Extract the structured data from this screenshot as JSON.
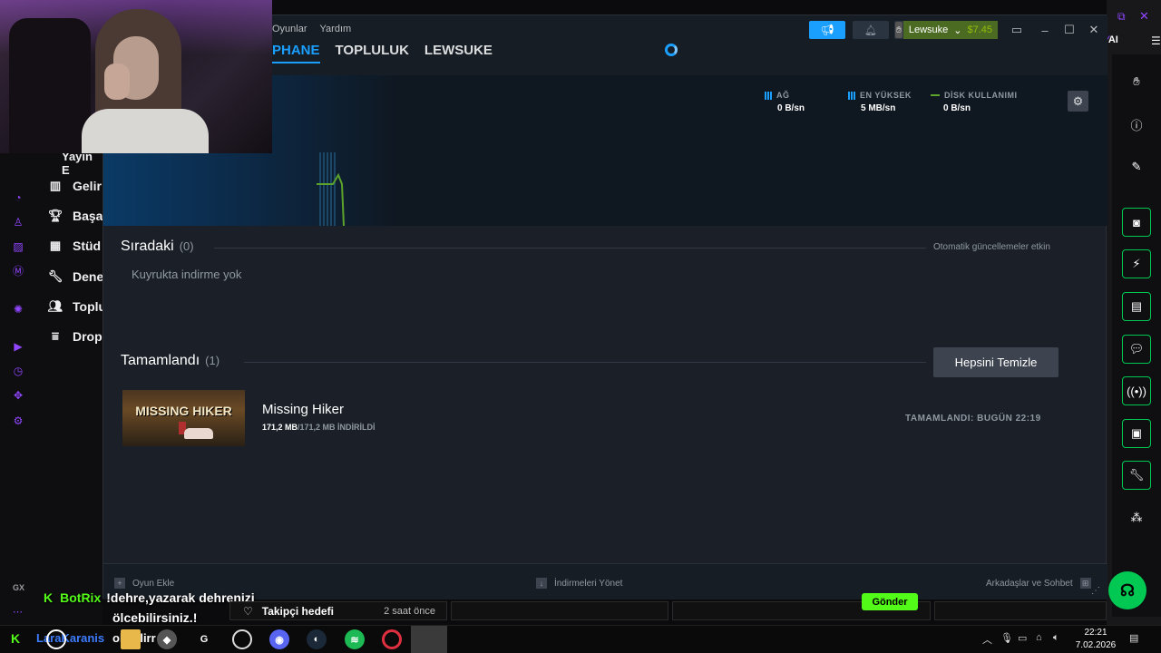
{
  "steam": {
    "menu": [
      "Oyunlar",
      "Yardım"
    ],
    "nav": [
      {
        "label": "PHANE",
        "active": true
      },
      {
        "label": "TOPLULUK",
        "active": false
      },
      {
        "label": "LEWSUKE",
        "active": false
      }
    ],
    "account": {
      "name": "Lewsuke",
      "balance": "$7.45"
    },
    "stats": [
      {
        "label": "AĞ",
        "value": "0 B/sn",
        "icon": "bar-chart-icon"
      },
      {
        "label": "EN YÜKSEK",
        "value": "5 MB/sn",
        "icon": "bar-chart-icon"
      },
      {
        "label": "DİSK KULLANIMI",
        "value": "0 B/sn",
        "icon": "line-icon"
      }
    ],
    "queue": {
      "title": "Sıradaki",
      "count": "(0)",
      "auto_updates": "Otomatik güncellemeler etkin",
      "empty": "Kuyrukta indirme yok"
    },
    "completed": {
      "title": "Tamamlandı",
      "count": "(1)",
      "clear_label": "Hepsini Temizle"
    },
    "game": {
      "thumb_text": "MISSING HIKER",
      "name": "Missing Hiker",
      "size_done": "171,2 MB",
      "size_rest": "/171,2 MB İNDİRİLDİ",
      "completed_text": "TAMAMLANDI: BUGÜN 22:19"
    },
    "bottom": {
      "add_game": "Oyun Ekle",
      "manage": "İndirmeleri Yönet",
      "friends": "Arkadaşlar ve Sohbet"
    }
  },
  "stream_sidebar": {
    "header": "Yayın E",
    "items": [
      "Gelir",
      "Başa",
      "Stüd",
      "Dene",
      "Toplu",
      "Drop"
    ]
  },
  "right_rail": {
    "ai_label": "AI"
  },
  "overlay": {
    "gx": "GX",
    "chat_user": "BotRix",
    "chat_line1": "!dehre,yazarak dehrenizi",
    "chat_line2": "ölcebilirsiniz.!",
    "follower_label": "Takipçi hedefi",
    "follower_time": "2 saat önce",
    "green_btn": "Gönder"
  },
  "taskbar": {
    "user": "LaraKaranis",
    "user2": "olabilirr",
    "time": "22:21",
    "date": "7.02.2026"
  },
  "colors": {
    "accent": "#1a9fff",
    "kick_green": "#53fc18",
    "steam_bg": "#1b2028"
  }
}
